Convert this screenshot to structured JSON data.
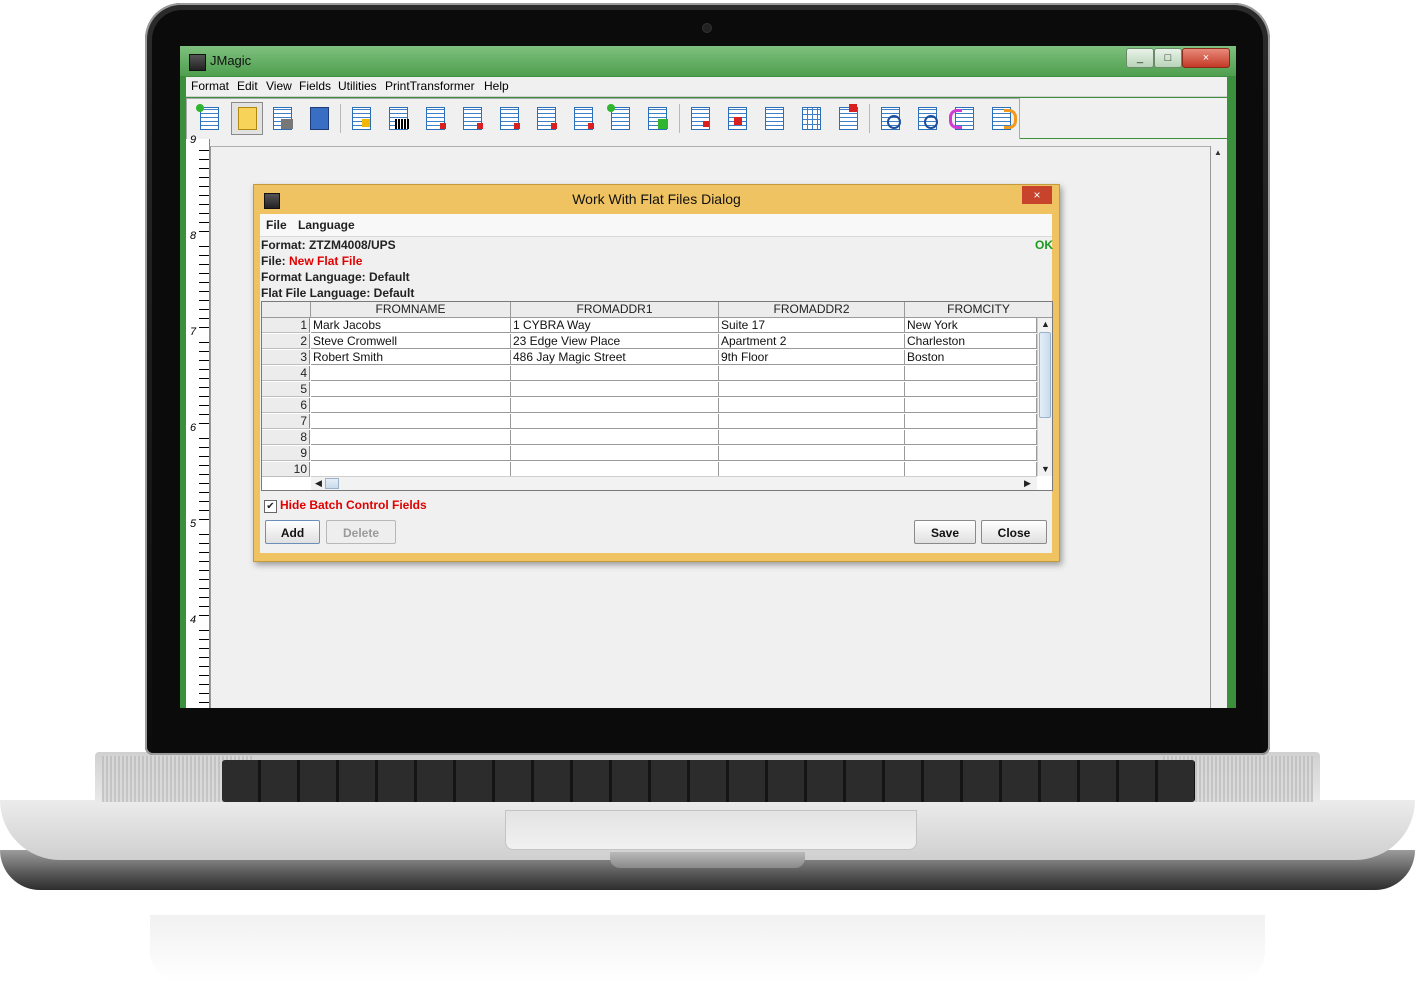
{
  "window": {
    "title": "JMagic",
    "controls": [
      "_",
      "□",
      "×"
    ]
  },
  "menubar": [
    "Format",
    "Edit",
    "View",
    "Fields",
    "Utilities",
    "PrintTransformer",
    "Help"
  ],
  "toolbar_icons": [
    "new-format-icon",
    "open-format-icon",
    "save-format-icon",
    "library-icon",
    "add-field-icon",
    "barcode-field-icon",
    "text-box-icon",
    "text-field-icon",
    "text-block-icon",
    "box-icon",
    "line-icon",
    "new-image-icon",
    "select-icon",
    "copy-icon",
    "paste-icon",
    "list-icon",
    "grid-icon",
    "print-preview-icon",
    "zoom-in-icon",
    "zoom-out-icon",
    "undo-icon",
    "redo-icon"
  ],
  "ruler": {
    "labels": [
      "9",
      "8",
      "7",
      "6",
      "5",
      "4"
    ]
  },
  "dialog": {
    "title": "Work With Flat Files Dialog",
    "close": "×",
    "menu": [
      "File",
      "Language"
    ],
    "format_label": "Format: ZTZM4008/UPS",
    "file_label": "File: ",
    "file_value": "New Flat File",
    "format_language": "Format Language: Default",
    "flat_file_language": "Flat File Language: Default",
    "status": "OK",
    "table": {
      "columns": [
        "FROMNAME",
        "FROMADDR1",
        "FROMADDR2",
        "FROMCITY"
      ],
      "rows": [
        {
          "n": "1",
          "cells": [
            "Mark Jacobs",
            "1 CYBRA Way",
            "Suite 17",
            "New York"
          ]
        },
        {
          "n": "2",
          "cells": [
            "Steve Cromwell",
            "23 Edge View Place",
            "Apartment 2",
            "Charleston"
          ]
        },
        {
          "n": "3",
          "cells": [
            "Robert Smith",
            "486 Jay Magic Street",
            "9th Floor",
            "Boston"
          ]
        },
        {
          "n": "4",
          "cells": [
            "",
            "",
            "",
            ""
          ]
        },
        {
          "n": "5",
          "cells": [
            "",
            "",
            "",
            ""
          ]
        },
        {
          "n": "6",
          "cells": [
            "",
            "",
            "",
            ""
          ]
        },
        {
          "n": "7",
          "cells": [
            "",
            "",
            "",
            ""
          ]
        },
        {
          "n": "8",
          "cells": [
            "",
            "",
            "",
            ""
          ]
        },
        {
          "n": "9",
          "cells": [
            "",
            "",
            "",
            ""
          ]
        },
        {
          "n": "10",
          "cells": [
            "",
            "",
            "",
            ""
          ]
        }
      ]
    },
    "hide_batch_label": "Hide Batch Control Fields",
    "hide_batch_checked": "✔",
    "buttons": {
      "add": "Add",
      "delete": "Delete",
      "save": "Save",
      "close": "Close"
    }
  }
}
